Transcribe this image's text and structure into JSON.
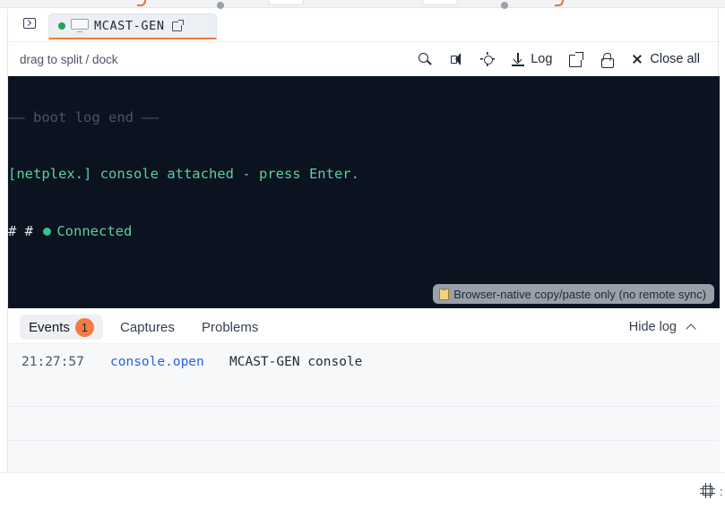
{
  "tab": {
    "label": "MCAST-GEN",
    "status_color": "#22a35a"
  },
  "toolbar": {
    "hint": "drag to split / dock",
    "log_label": "Log",
    "close_all_label": "Close all",
    "icons": [
      "search-icon",
      "speaker-icon",
      "sun-icon",
      "download-icon",
      "popout-icon",
      "lock-icon",
      "close-icon"
    ]
  },
  "terminal": {
    "line1": "—— boot log end ——",
    "line2": "[netplex.] console attached - press Enter.",
    "line3_prompt": "# #",
    "line3_status": "Connected",
    "copy_note": "Browser-native copy/paste only (no remote sync)"
  },
  "log": {
    "tabs": [
      {
        "label": "Events",
        "badge": "1"
      },
      {
        "label": "Captures"
      },
      {
        "label": "Problems"
      }
    ],
    "hide_label": "Hide log",
    "rows": [
      {
        "time": "21:27:57",
        "event": "console.open",
        "message": "MCAST-GEN console"
      }
    ]
  },
  "bottom": {
    "trail": ":"
  },
  "colors": {
    "accent": "#f07a3a",
    "terminal_bg": "#0b1220",
    "connected": "#34c38f",
    "event_link": "#2563eb"
  }
}
